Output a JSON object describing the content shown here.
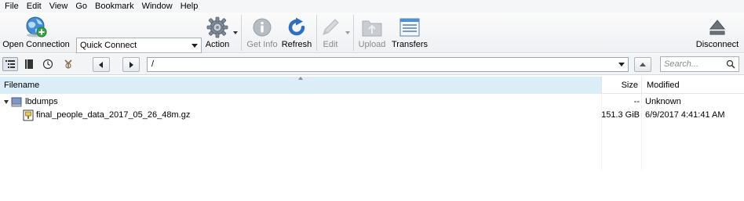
{
  "menu": [
    "File",
    "Edit",
    "View",
    "Go",
    "Bookmark",
    "Window",
    "Help"
  ],
  "toolbar": {
    "open_connection": "Open Connection",
    "quick_connect": "Quick Connect",
    "action": "Action",
    "get_info": "Get Info",
    "refresh": "Refresh",
    "edit": "Edit",
    "upload": "Upload",
    "transfers": "Transfers",
    "disconnect": "Disconnect"
  },
  "navbar": {
    "path": "/",
    "search_placeholder": "Search...",
    "icons": [
      "browser-view-icon",
      "bookmarks-icon",
      "history-icon",
      "bonjour-icon"
    ]
  },
  "columns": {
    "filename": "Filename",
    "size": "Size",
    "modified": "Modified"
  },
  "rows": [
    {
      "name": "lbdumps",
      "size": "--",
      "modified": "Unknown",
      "type": "folder"
    },
    {
      "name": "final_people_data_2017_05_26_48m.gz",
      "size": "151.3 GiB",
      "modified": "6/9/2017 4:41:41 AM",
      "type": "file"
    }
  ],
  "colors": {
    "header_selected": "#dbeef8",
    "refresh_blue": "#2f6fc2"
  }
}
